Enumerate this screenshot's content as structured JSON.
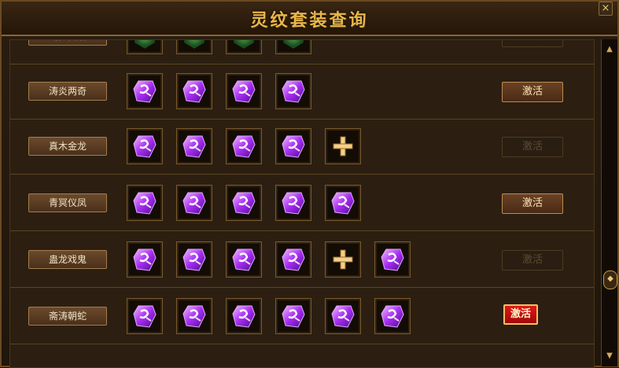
{
  "window": {
    "title": "灵纹套装查询",
    "close_label": "×"
  },
  "colors": {
    "activate_red": "#d01010",
    "gem_purple": "#9a2cf0",
    "gem_green": "#2e7a3a",
    "gold": "#e8b64a"
  },
  "rows": [
    {
      "name": "鸣罗白鼎",
      "activate_label": "激活",
      "activate_state": "disabled",
      "slots": [
        "green-rune-gem",
        "green-rune-gem",
        "green-rune-gem",
        "green-rune-gem"
      ]
    },
    {
      "name": "涛炎两奇",
      "activate_label": "激活",
      "activate_state": "enabled",
      "slots": [
        "purple-rune-gem",
        "purple-rune-gem",
        "purple-rune-gem",
        "purple-rune-gem"
      ]
    },
    {
      "name": "真木金龙",
      "activate_label": "激活",
      "activate_state": "disabled",
      "slots": [
        "purple-rune-gem",
        "purple-rune-gem",
        "purple-rune-gem",
        "purple-rune-gem",
        "plus-icon"
      ]
    },
    {
      "name": "青冥仪凤",
      "activate_label": "激活",
      "activate_state": "enabled",
      "slots": [
        "purple-rune-gem",
        "purple-rune-gem",
        "purple-rune-gem",
        "purple-rune-gem",
        "purple-rune-gem"
      ]
    },
    {
      "name": "蛊龙戏鬼",
      "activate_label": "激活",
      "activate_state": "disabled",
      "slots": [
        "purple-rune-gem",
        "purple-rune-gem",
        "purple-rune-gem",
        "purple-rune-gem",
        "plus-icon",
        "purple-rune-gem"
      ]
    },
    {
      "name": "斋涛朝蛇",
      "activate_label": "激活",
      "activate_state": "highlighted",
      "slots": [
        "purple-rune-gem",
        "purple-rune-gem",
        "purple-rune-gem",
        "purple-rune-gem",
        "purple-rune-gem",
        "purple-rune-gem"
      ]
    }
  ],
  "scrollbar": {
    "up_icon": "scroll-up-icon",
    "down_icon": "scroll-down-icon",
    "thumb_icon": "scroll-thumb-icon"
  }
}
